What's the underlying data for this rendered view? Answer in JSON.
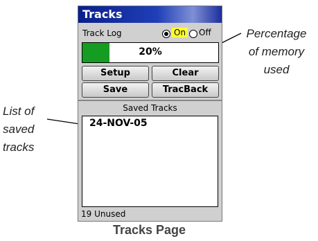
{
  "title": "Tracks",
  "track_log": {
    "label": "Track Log",
    "on_label": "On",
    "off_label": "Off",
    "selected": "On"
  },
  "memory": {
    "percent_label": "20%",
    "fraction_used": 0.2,
    "fill_color": "#159c22"
  },
  "buttons": {
    "setup": "Setup",
    "clear": "Clear",
    "save": "Save",
    "tracback": "TracBack"
  },
  "saved_tracks": {
    "header": "Saved Tracks",
    "items": [
      "24-NOV-05"
    ],
    "unused": "19 Unused"
  },
  "callouts": {
    "memory_line1": "Percentage",
    "memory_line2": "of memory",
    "memory_line3": "used",
    "list_line1": "List of",
    "list_line2": "saved",
    "list_line3": "tracks"
  },
  "caption": "Tracks Page"
}
